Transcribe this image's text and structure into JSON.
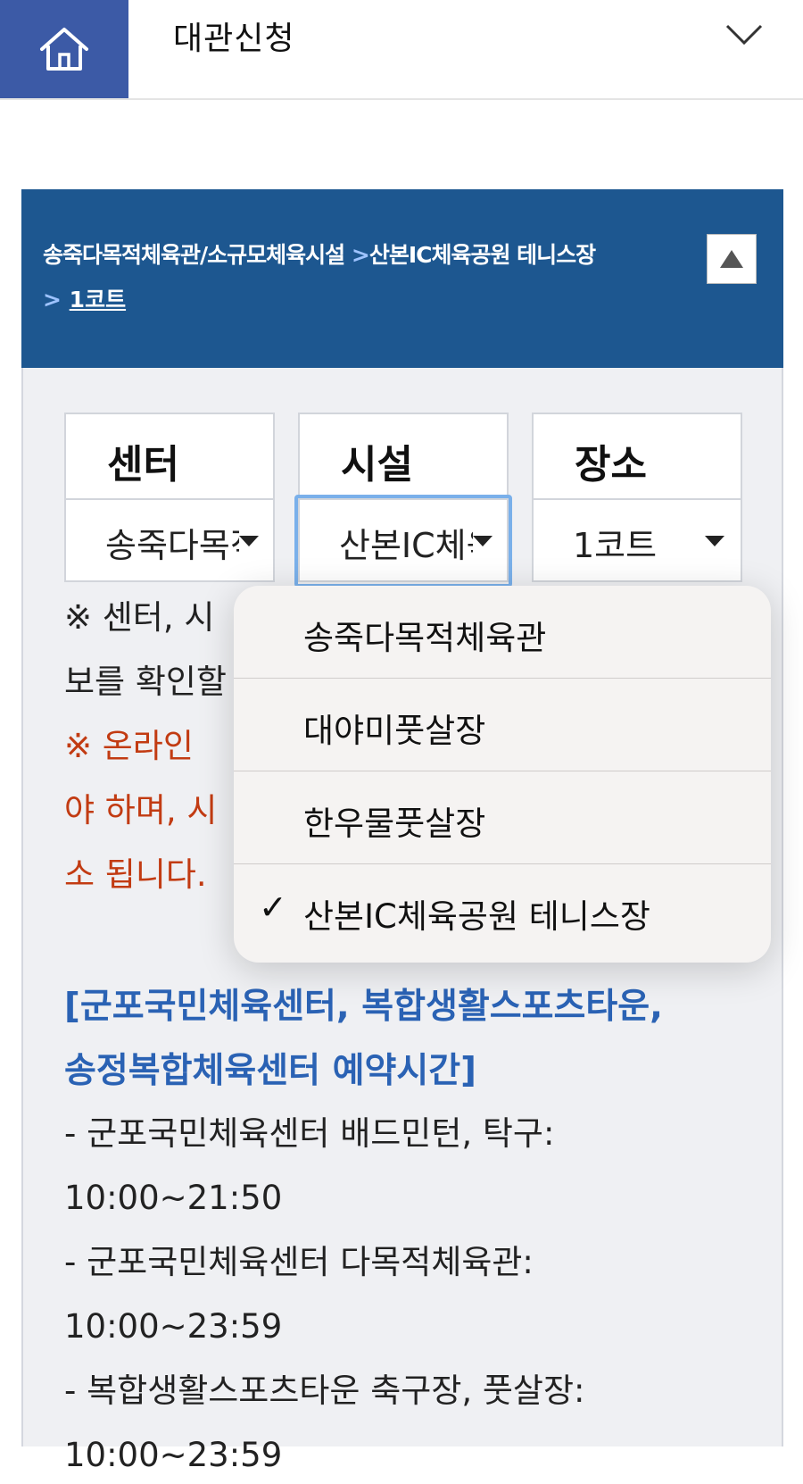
{
  "header": {
    "title": "대관신청",
    "icons": {
      "home": "home-icon",
      "expand": "chevron-down-icon"
    },
    "colors": {
      "home_bg": "#3c5aa6"
    }
  },
  "breadcrumb": {
    "center": "송죽다목적체육관/소규모체육시설",
    "sep1": ">",
    "facility": "산본IC체육공원 테니스장",
    "sep2": ">",
    "place": "1코트",
    "colors": {
      "bar_bg": "#1d5790"
    }
  },
  "selectors": [
    {
      "header": "센터",
      "value": "송죽다목적체육관"
    },
    {
      "header": "시설",
      "value": "산본IC체육공원 테니스장"
    },
    {
      "header": "장소",
      "value": "1코트"
    }
  ],
  "notice": {
    "line1": "※ 센터, 시",
    "line2": "보를 확인할",
    "red1": "※ 온라인",
    "red2": "야 하며, 시",
    "red3": "소 됩니다."
  },
  "schedule": {
    "heading1": "[군포국민체육센터, 복합생활스포츠타운,",
    "heading2": "송정복합체육센터 예약시간]",
    "items": [
      "- 군포국민체육센터 배드민턴, 탁구:",
      "10:00~21:50",
      "- 군포국민체육센터 다목적체육관:",
      "10:00~23:59",
      "- 복합생활스포츠타운 축구장, 풋살장:",
      "10:00~23:59"
    ]
  },
  "dropdown": {
    "options": [
      {
        "label": "송죽다목적체육관",
        "selected": false
      },
      {
        "label": "대야미풋살장",
        "selected": false
      },
      {
        "label": "한우물풋살장",
        "selected": false
      },
      {
        "label": "산본IC체육공원 테니스장",
        "selected": true
      }
    ],
    "check_mark": "✓"
  }
}
